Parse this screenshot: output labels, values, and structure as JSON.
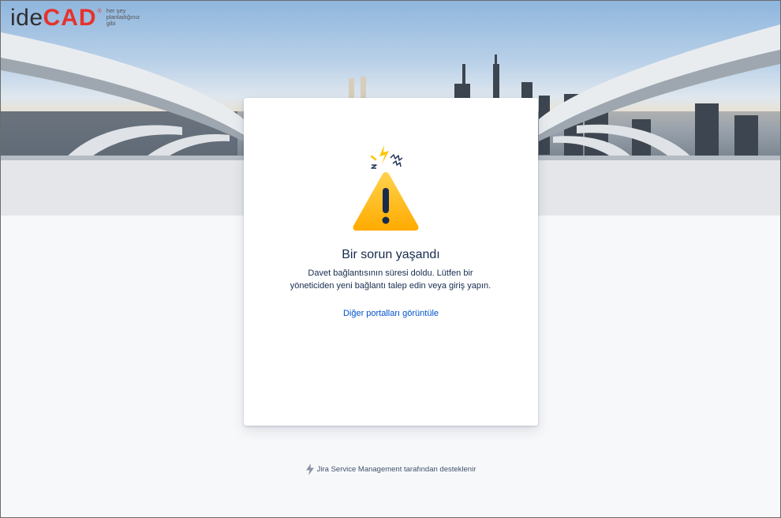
{
  "brand": {
    "name_part1": "ide",
    "name_part2": "CAD",
    "registered": "®",
    "tagline_lines": [
      "her şey",
      "planladığınız",
      "gibi"
    ]
  },
  "error": {
    "title": "Bir sorun yaşandı",
    "message": "Davet bağlantısının süresi doldu. Lütfen bir yöneticiden yeni bağlantı talep edin veya giriş yapın.",
    "link_label": "Diğer portalları görüntüle"
  },
  "footer": {
    "powered_by": "Jira Service Management tarafından desteklenir",
    "icon": "lightning-bolt-icon"
  },
  "colors": {
    "brand_red": "#e5322d",
    "link_blue": "#0052cc",
    "warning_yellow": "#ffc400",
    "text_dark": "#172b4d"
  }
}
